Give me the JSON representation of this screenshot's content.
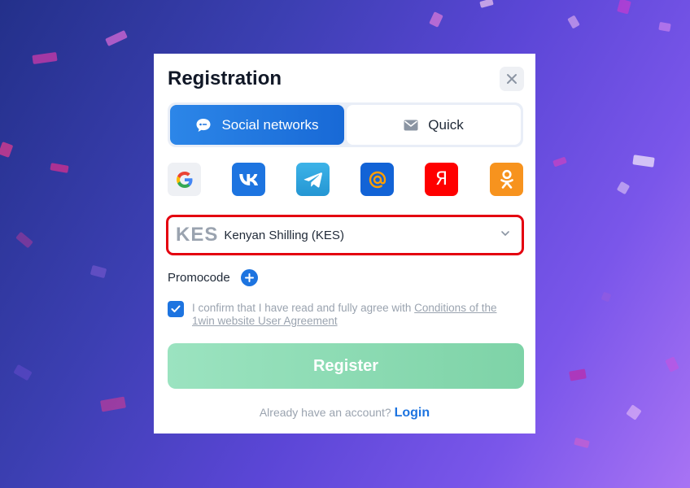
{
  "background": {
    "gradient": [
      "#23308a",
      "#5b46d6",
      "#a873f4"
    ]
  },
  "modal": {
    "title": "Registration",
    "close_icon": "close-icon",
    "tabs": [
      {
        "label": "Social networks",
        "icon": "chat-bubble-icon",
        "active": true
      },
      {
        "label": "Quick",
        "icon": "envelope-icon",
        "active": false
      }
    ],
    "social": [
      {
        "name": "google",
        "icon": "google-icon",
        "bg": "#eef0f4"
      },
      {
        "name": "vk",
        "icon": "vk-icon",
        "bg": "#1d74e0"
      },
      {
        "name": "telegram",
        "icon": "telegram-icon",
        "bg": "#2ea6dd"
      },
      {
        "name": "mail-ru",
        "icon": "at-sign-icon",
        "bg": "#1263d6"
      },
      {
        "name": "yandex",
        "icon": "yandex-icon",
        "bg": "#ff0000",
        "glyph": "Я"
      },
      {
        "name": "odnoklassniki",
        "icon": "odnoklassniki-icon",
        "bg": "#f7931e"
      }
    ],
    "currency": {
      "code": "KES",
      "name": "Kenyan Shilling (KES)"
    },
    "promocode_label": "Promocode",
    "agreement": {
      "text": "I confirm that I have read and fully agree with ",
      "link": "Conditions of the 1win website User Agreement",
      "checked": true
    },
    "register_label": "Register",
    "login": {
      "prompt": "Already have an account?",
      "link": "Login"
    }
  },
  "colors": {
    "accent": "#1d74e0",
    "register": "#8fdcb6",
    "highlight_border": "#e4000f"
  }
}
